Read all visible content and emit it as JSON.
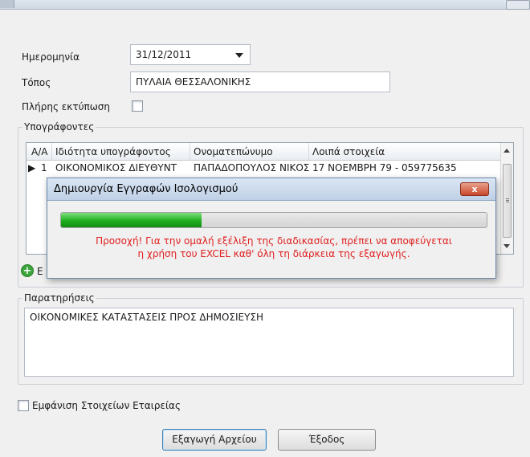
{
  "form": {
    "date_label": "Ημερομηνία",
    "date_value": "31/12/2011",
    "place_label": "Τόπος",
    "place_value": "ΠΥΛΑΙΑ ΘΕΣΣΑΛΟΝΙΚΗΣ",
    "full_print_label": "Πλήρης εκτύπωση",
    "full_print_checked": false
  },
  "signers": {
    "group_label": "Υπογράφοντες",
    "columns": [
      "Α/Α",
      "Ιδιότητα υπογράφοντος",
      "Ονοματεπώνυμο",
      "Λοιπά στοιχεία"
    ],
    "rows": [
      [
        "1",
        "ΟΙΚΟΝΟΜΙΚΟΣ ΔΙΕΥΘΥΝΤ",
        "ΠΑΠΑΔΟΠΟΥΛΟΣ ΝΙΚΟΣ",
        "17 ΝΟΕΜΒΡΗ 79 - 059775635"
      ]
    ],
    "add_label": "E"
  },
  "notes": {
    "group_label": "Παρατηρήσεις",
    "value": "ΟΙΚΟΝΟΜΙΚΕΣ ΚΑΤΑΣΤΑΣΕΙΣ ΠΡΟΣ ΔΗΜΟΣΙΕΥΣΗ"
  },
  "show_company": {
    "label": "Εμφάνιση Στοιχείων Εταιρείας",
    "checked": false
  },
  "buttons": {
    "export": "Εξαγωγή Αρχείου",
    "exit": "Έξοδος"
  },
  "modal": {
    "title": "Δημιουργία Εγγραφών Ισολογισμού",
    "close": "x",
    "progress_fraction": 0.33,
    "warning_line1": "Προσοχή! Για την ομαλή εξέλιξη της διαδικασίας, πρέπει να αποφεύγεται",
    "warning_line2": "η χρήση του EXCEL καθ' όλη τη διάρκεια της εξαγωγής."
  },
  "colors": {
    "warning": "#e02020",
    "progress": "#1fae1f",
    "close_button": "#c8472b"
  }
}
